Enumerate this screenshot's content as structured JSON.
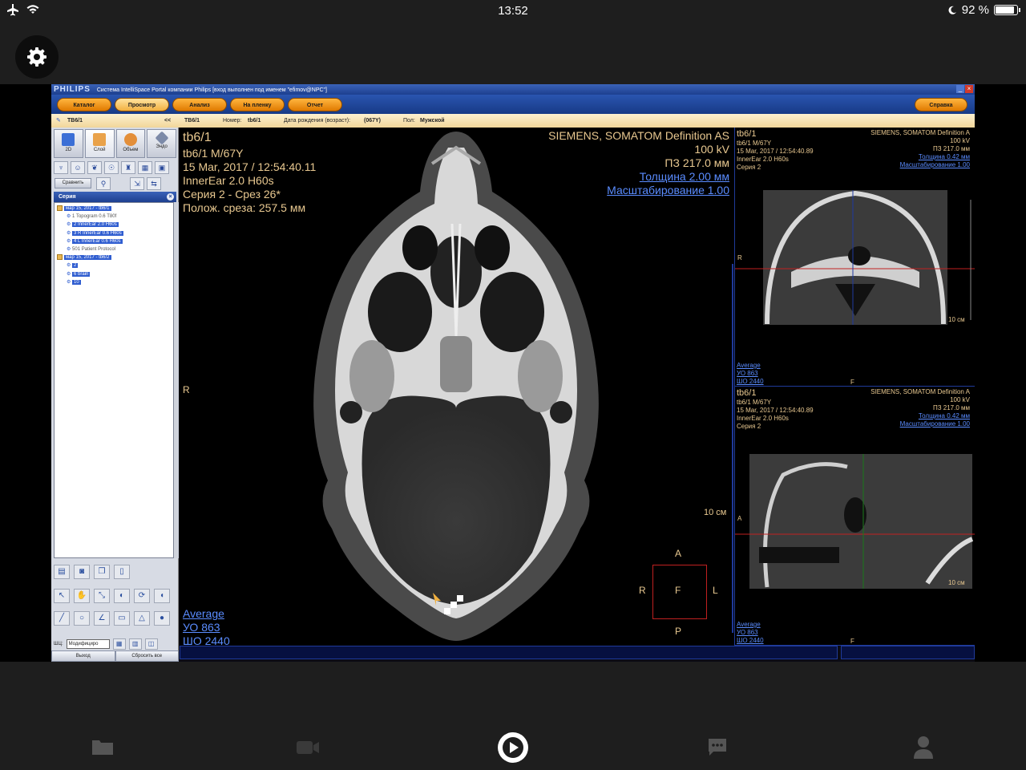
{
  "status_bar": {
    "time": "13:52",
    "battery": "92 %",
    "battery_level": 0.92
  },
  "app": {
    "brand": "PHILIPS",
    "window_title": "Система IntelliSpace Portal компании Philips [вход выполнен под именем \"efimov@NPC\"]",
    "menu": [
      "Каталог",
      "Просмотр",
      "Анализ",
      "На пленку",
      "Отчет"
    ],
    "active_menu": "Просмотр",
    "help": "Справка"
  },
  "info_bar": {
    "patient_tab": "TB6/1",
    "collapse": "<<",
    "patient_short": "TB6/1",
    "number_label": "Номер:",
    "number_value": "tb6/1",
    "dob_label": "Дата рождения (возраст):",
    "dob_value": "(067Y)",
    "sex_label": "Пол:",
    "sex_value": "Мужской"
  },
  "left_panel": {
    "tabs": [
      "2D",
      "Слой",
      "Объем",
      "Эндо"
    ],
    "compare": "Сравнить",
    "series_header": "Серия",
    "tree": [
      {
        "label": "мар 15, 2017 - tb6/1",
        "level": 0,
        "selected": true,
        "folder": true
      },
      {
        "label": "1  Topogram  0.6  T80f",
        "level": 1,
        "selected": false
      },
      {
        "label": "2  InnerEar  2.0  H60s",
        "level": 1,
        "selected": true
      },
      {
        "label": "3  R  InnerEar  0.6  H60s",
        "level": 1,
        "selected": true
      },
      {
        "label": "4  L  InnerEar  0.6  H60s",
        "level": 1,
        "selected": true
      },
      {
        "label": "501  Patient Protocol",
        "level": 1,
        "selected": false
      },
      {
        "label": "мар 15, 2017 - tb6/2",
        "level": 0,
        "selected": true,
        "folder": true
      },
      {
        "label": "2",
        "level": 1,
        "selected": true
      },
      {
        "label": "6  brain",
        "level": 1,
        "selected": true
      },
      {
        "label": "10",
        "level": 1,
        "selected": true
      }
    ],
    "wl_label": "ШЦ:",
    "wl_select": "Модифициро",
    "exit": "Выход",
    "reset_all": "Сбросить все"
  },
  "main_view": {
    "top_left": [
      "tb6/1",
      "tb6/1 M/67Y",
      "15 Mar, 2017 / 12:54:40.11",
      "InnerEar  2.0  H60s",
      "Серия 2 - Срез 26*",
      "Полож. среза: 257.5 мм"
    ],
    "top_right": [
      "SIEMENS, SOMATOM Definition AS",
      "100 kV",
      "ПЗ 217.0 мм"
    ],
    "top_right_links": [
      "Толщина 2.00 мм",
      "Масштабирование 1.00"
    ],
    "bottom_left_links": [
      "Average",
      "УО   863",
      "ШО  2440"
    ],
    "side_left": "R",
    "scale": "10 см",
    "orient": {
      "a": "A",
      "p": "P",
      "r": "R",
      "l": "L",
      "f": "F"
    }
  },
  "coronal_view": {
    "top_left": [
      "tb6/1",
      "tb6/1 M/67Y",
      "15 Mar, 2017 / 12:54:40.89",
      "InnerEar  2.0  H60s",
      "Серия 2"
    ],
    "top_right": [
      "SIEMENS, SOMATOM Definition A",
      "100 kV",
      "ПЗ 217.0 мм"
    ],
    "top_right_links": [
      "Толщина 0.42 мм",
      "Масштабирование 1.00"
    ],
    "bottom_left_links": [
      "Average",
      "УО   863",
      "ШО  2440"
    ],
    "side": "R",
    "bottom_marker": "F",
    "scale": "10 см"
  },
  "sagittal_view": {
    "top_left": [
      "tb6/1",
      "tb6/1 M/67Y",
      "15 Mar, 2017 / 12:54:40.89",
      "InnerEar  2.0  H60s",
      "Серия 2"
    ],
    "top_right": [
      "SIEMENS, SOMATOM Definition A",
      "100 kV",
      "ПЗ 217.0 мм"
    ],
    "top_right_links": [
      "Толщина 0.42 мм",
      "Масштабирование 1.00"
    ],
    "bottom_left_links": [
      "Average",
      "УО   863",
      "ШО  2440"
    ],
    "side": "A",
    "bottom_marker": "F",
    "scale": "10 см"
  },
  "bottom_nav": [
    "folder-icon",
    "video-icon",
    "play-icon",
    "chat-icon",
    "person-icon"
  ],
  "colors": {
    "overlay_text": "#e8c890",
    "link": "#5a8cff",
    "menu_orange": "#f0a020",
    "title_blue": "#1d3f8f"
  }
}
